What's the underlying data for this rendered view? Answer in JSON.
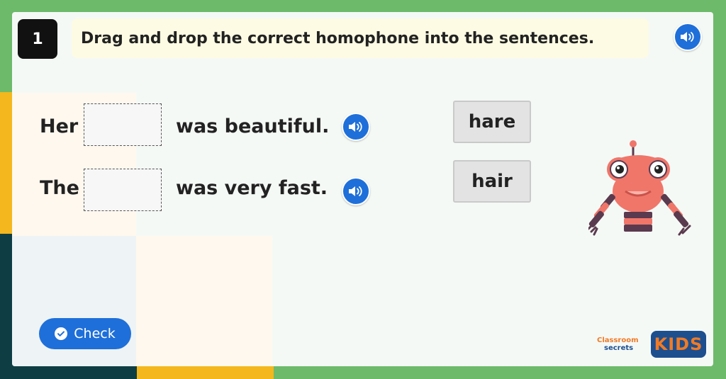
{
  "question": {
    "number": "1",
    "instruction": "Drag and drop the correct homophone into the sentences."
  },
  "sentences": [
    {
      "before": "Her",
      "after": "was beautiful."
    },
    {
      "before": "The",
      "after": "was very fast."
    }
  ],
  "word_options": [
    "hare",
    "hair"
  ],
  "check_button": {
    "label": "Check"
  },
  "logo": {
    "brand_top": "Classroom",
    "brand_bottom": "secrets",
    "kids": "KIDS"
  },
  "colors": {
    "accent_blue": "#1e6fd9",
    "page_green": "#6dba6a",
    "instruction_bg": "#fdfbe3",
    "robot_coral": "#f0766a",
    "robot_stripe": "#5a3a4e",
    "kids_navy": "#1d4f8f",
    "kids_orange": "#f07a25"
  },
  "icons": [
    "speaker-icon",
    "check-circle-icon",
    "robot-mascot",
    "classroom-secrets-kids-logo"
  ]
}
